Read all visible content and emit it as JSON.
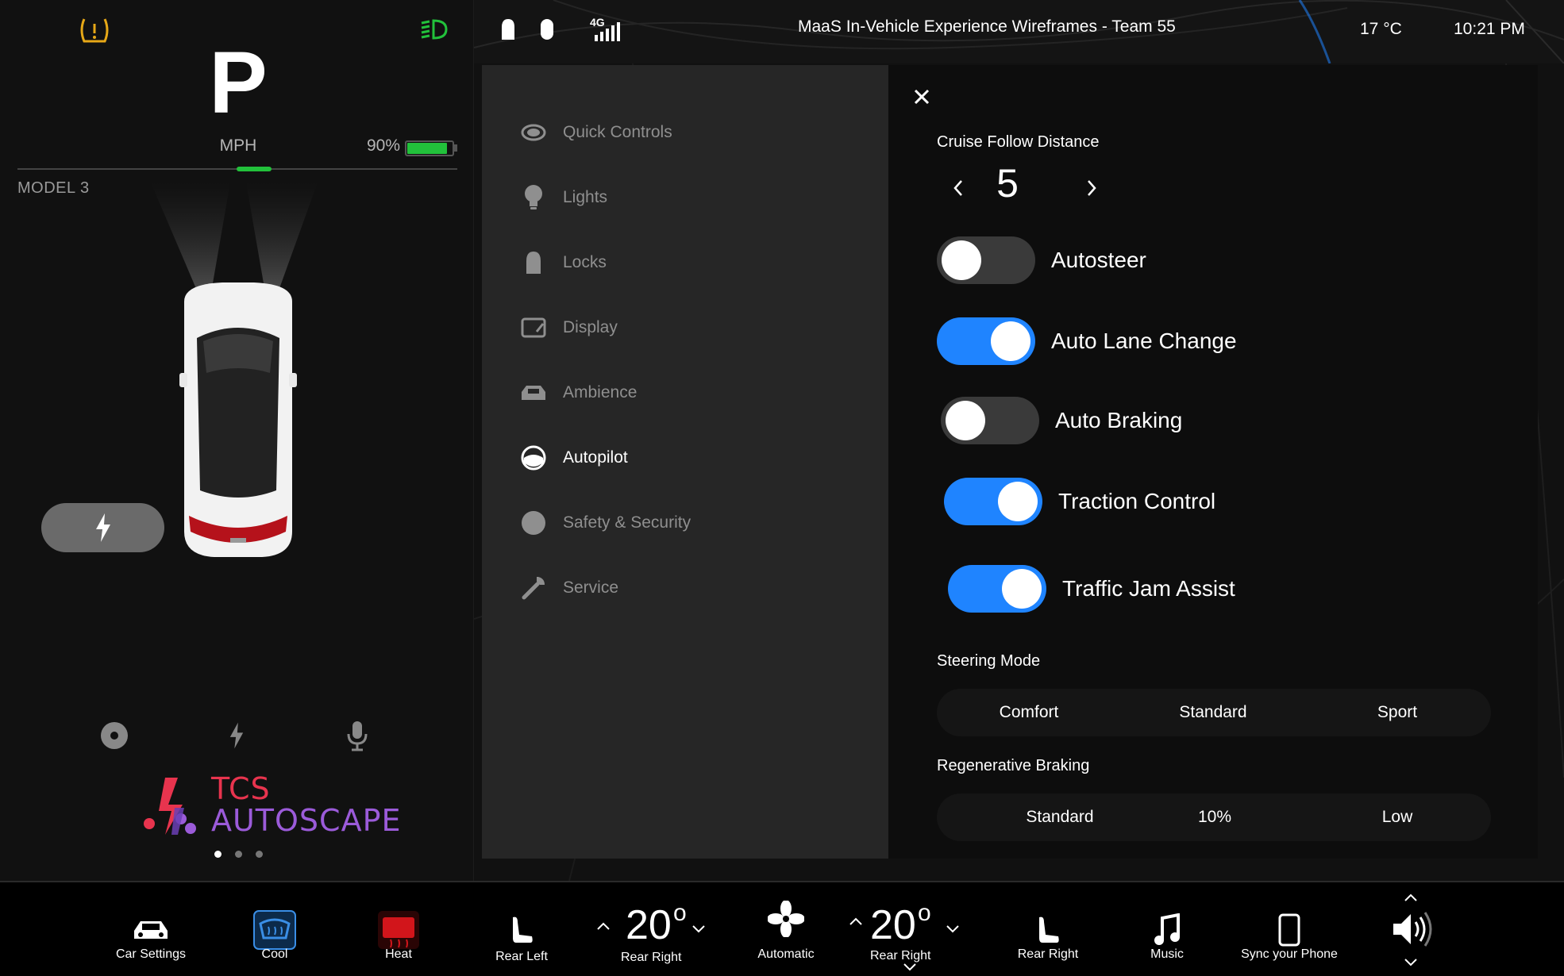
{
  "cluster": {
    "gear": "P",
    "speed_unit": "MPH",
    "battery_percent": "90%",
    "battery_level": 0.9,
    "model": "MODEL 3",
    "logo_line1": "TCS",
    "logo_line2": "AUTOSCAPE",
    "page_dot_active": 0,
    "page_dots": 3
  },
  "status_bar": {
    "network": "4G",
    "title": "MaaS  In-Vehicle Experience Wireframes - Team 55",
    "temperature": "17 °C",
    "time": "10:21 PM"
  },
  "menu": {
    "items": [
      {
        "label": "Quick Controls",
        "icon": "eye-icon",
        "active": false
      },
      {
        "label": "Lights",
        "icon": "bulb-icon",
        "active": false
      },
      {
        "label": "Locks",
        "icon": "lock-icon",
        "active": false
      },
      {
        "label": "Display",
        "icon": "display-icon",
        "active": false
      },
      {
        "label": "Ambience",
        "icon": "car-seat-icon",
        "active": false
      },
      {
        "label": "Autopilot",
        "icon": "steering-wheel-icon",
        "active": true
      },
      {
        "label": "Safety & Security",
        "icon": "shield-icon",
        "active": false
      },
      {
        "label": "Service",
        "icon": "wrench-icon",
        "active": false
      }
    ]
  },
  "autopilot": {
    "follow_distance_title": "Cruise Follow Distance",
    "follow_distance_value": "5",
    "toggles": [
      {
        "label": "Autosteer",
        "on": false
      },
      {
        "label": "Auto Lane Change",
        "on": true
      },
      {
        "label": "Auto Braking",
        "on": false
      },
      {
        "label": "Traction Control",
        "on": true
      },
      {
        "label": "Traffic Jam Assist",
        "on": true
      }
    ],
    "steering_mode": {
      "title": "Steering Mode",
      "options": [
        "Comfort",
        "Standard",
        "Sport"
      ]
    },
    "regen_braking": {
      "title": "Regenerative Braking",
      "options": [
        "Standard",
        "10%",
        "Low"
      ]
    }
  },
  "dock": {
    "car_settings": "Car Settings",
    "cool": "Cool",
    "heat": "Heat",
    "rear_left": "Rear Left",
    "left_temp": "20",
    "left_temp_label": "Rear Right",
    "fan": "Automatic",
    "right_temp": "20",
    "right_temp_label": "Rear Right",
    "rear_right": "Rear Right",
    "music": "Music",
    "sync_phone": "Sync your Phone",
    "degree_symbol": "o"
  },
  "colors": {
    "accent_blue": "#1f84ff",
    "battery_green": "#22c13b",
    "warning_amber": "#e6a817",
    "heat_red": "#d2151b",
    "cool_blue": "#3a8ee6"
  }
}
